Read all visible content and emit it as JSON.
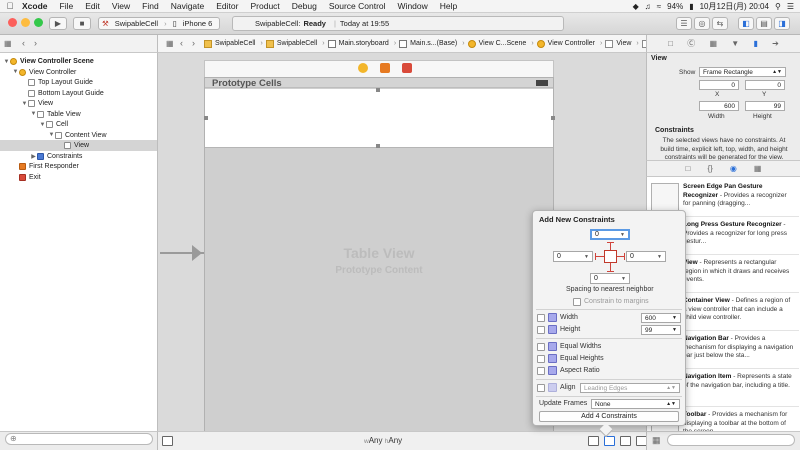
{
  "menubar": {
    "app": "Xcode",
    "items": [
      "File",
      "Edit",
      "View",
      "Find",
      "Navigate",
      "Editor",
      "Product",
      "Debug",
      "Source Control",
      "Window",
      "Help"
    ],
    "battery": "94%",
    "datetime": "10月12日(月) 20:04"
  },
  "toolbar": {
    "scheme_project": "SwipableCell",
    "scheme_device": "iPhone 6",
    "status_project": "SwipableCell:",
    "status_state": "Ready",
    "status_time": "Today at 19:55"
  },
  "navigator": {
    "rows": [
      {
        "label": "View Controller Scene",
        "indent": 0,
        "disc": "▼",
        "icon": "vc",
        "bold": true
      },
      {
        "label": "View Controller",
        "indent": 1,
        "disc": "▼",
        "icon": "vc",
        "bold": false
      },
      {
        "label": "Top Layout Guide",
        "indent": 2,
        "disc": "",
        "icon": "",
        "bold": false
      },
      {
        "label": "Bottom Layout Guide",
        "indent": 2,
        "disc": "",
        "icon": "",
        "bold": false
      },
      {
        "label": "View",
        "indent": 2,
        "disc": "▼",
        "icon": "",
        "bold": false
      },
      {
        "label": "Table View",
        "indent": 3,
        "disc": "▼",
        "icon": "",
        "bold": false
      },
      {
        "label": "Cell",
        "indent": 4,
        "disc": "▼",
        "icon": "",
        "bold": false
      },
      {
        "label": "Content View",
        "indent": 5,
        "disc": "▼",
        "icon": "",
        "bold": false
      },
      {
        "label": "View",
        "indent": 6,
        "disc": "",
        "icon": "",
        "bold": false,
        "selected": true
      },
      {
        "label": "Constraints",
        "indent": 3,
        "disc": "▶",
        "icon": "cs",
        "bold": false
      },
      {
        "label": "First Responder",
        "indent": 1,
        "disc": "",
        "icon": "fr",
        "bold": false
      },
      {
        "label": "Exit",
        "indent": 1,
        "disc": "",
        "icon": "ex",
        "bold": false
      }
    ]
  },
  "jumpbar": {
    "crumbs": [
      {
        "label": "SwipableCell",
        "icon": "fold"
      },
      {
        "label": "SwipableCell",
        "icon": "fold"
      },
      {
        "label": "Main.storyboard",
        "icon": "sb"
      },
      {
        "label": "Main.s...(Base)",
        "icon": "sb"
      },
      {
        "label": "View C...Scene",
        "icon": "vc"
      },
      {
        "label": "View Controller",
        "icon": "vc"
      },
      {
        "label": "View",
        "icon": ""
      },
      {
        "label": "Table View",
        "icon": ""
      },
      {
        "label": "Cell",
        "icon": ""
      },
      {
        "label": "Content View",
        "icon": ""
      },
      {
        "label": "View",
        "icon": ""
      }
    ]
  },
  "canvas": {
    "prototype_cells": "Prototype Cells",
    "table_view": "Table View",
    "prototype_content": "Prototype Content",
    "size_w": "Any",
    "size_h": "Any",
    "size_w_prefix": "w",
    "size_h_prefix": "h"
  },
  "popover": {
    "title": "Add New Constraints",
    "top": "0",
    "left": "0",
    "right": "0",
    "bottom": "0",
    "spacing_note": "Spacing to nearest neighbor",
    "constrain_margins": "Constrain to margins",
    "width_label": "Width",
    "width_value": "600",
    "height_label": "Height",
    "height_value": "99",
    "equal_widths": "Equal Widths",
    "equal_heights": "Equal Heights",
    "aspect_ratio": "Aspect Ratio",
    "align_label": "Align",
    "align_value": "Leading Edges",
    "update_frames_label": "Update Frames",
    "update_frames_value": "None",
    "add_button": "Add 4 Constraints"
  },
  "inspector": {
    "section": "View",
    "show_label": "Show",
    "show_value": "Frame Rectangle",
    "x_value": "0",
    "y_value": "0",
    "x_label": "X",
    "y_label": "Y",
    "width_value": "600",
    "height_value": "99",
    "width_label": "Width",
    "height_label": "Height",
    "constraints_title": "Constraints",
    "constraints_text": "The selected views have no constraints. At build time, explicit left, top, width, and height constraints will be generated for the view."
  },
  "library": {
    "items": [
      {
        "title": "Screen Edge Pan Gesture Recognizer",
        "desc": " - Provides a recognizer for panning (dragging..."
      },
      {
        "title": "Long Press Gesture Recognizer",
        "desc": " - Provides a recognizer for long press gestur..."
      },
      {
        "title": "View",
        "desc": " - Represents a rectangular region in which it draws and receives events."
      },
      {
        "title": "Container View",
        "desc": " - Defines a region of a view controller that can include a child view controller."
      },
      {
        "title": "Navigation Bar",
        "desc": " - Provides a mechanism for displaying a navigation bar just below the sta..."
      },
      {
        "title": "Navigation Item",
        "desc": " - Represents a state of the navigation bar, including a title."
      },
      {
        "title": "Toolbar",
        "desc": " - Provides a mechanism for displaying a toolbar at the bottom of the screen."
      }
    ]
  },
  "colors": {
    "accent": "#2a6fd8",
    "constraint_red": "#d0433a",
    "close": "#fc605c",
    "minimize": "#fdbc40",
    "zoom": "#34c84a"
  }
}
